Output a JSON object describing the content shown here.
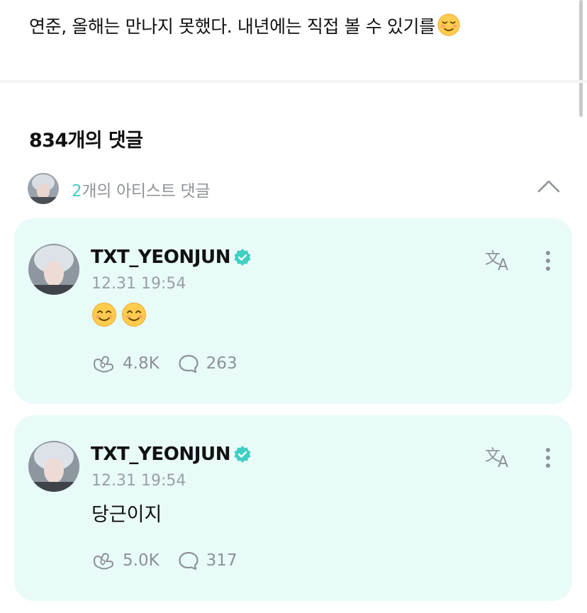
{
  "post": {
    "text": "연준, 올해는 만나지 못했다. 내년에는 직접 볼 수 있기를",
    "trailing_emoji": "relieved-smiling-face"
  },
  "comments_header": {
    "count_label": "834개의 댓글"
  },
  "artist_comments": {
    "count": "2",
    "label": "개의 아티스트 댓글",
    "expanded": true
  },
  "comments": [
    {
      "author": "TXT_YEONJUN",
      "verified": true,
      "timestamp": "12.31 19:54",
      "content": "",
      "content_emojis": [
        "smiling-face",
        "smiling-face"
      ],
      "likes": "4.8K",
      "replies": "263"
    },
    {
      "author": "TXT_YEONJUN",
      "verified": true,
      "timestamp": "12.31 19:54",
      "content": "당근이지",
      "content_emojis": [],
      "likes": "5.0K",
      "replies": "317"
    }
  ],
  "colors": {
    "card_background": "#e8fbf8",
    "accent": "#3fcfc3",
    "muted_text": "#8c9196",
    "divider": "#f3f4f6"
  },
  "icons": {
    "verified": "verified-badge-icon",
    "translate": "translate-icon",
    "more": "more-vertical-icon",
    "like": "heart-hands-icon",
    "reply": "comment-bubble-icon",
    "collapse": "chevron-up-icon"
  }
}
